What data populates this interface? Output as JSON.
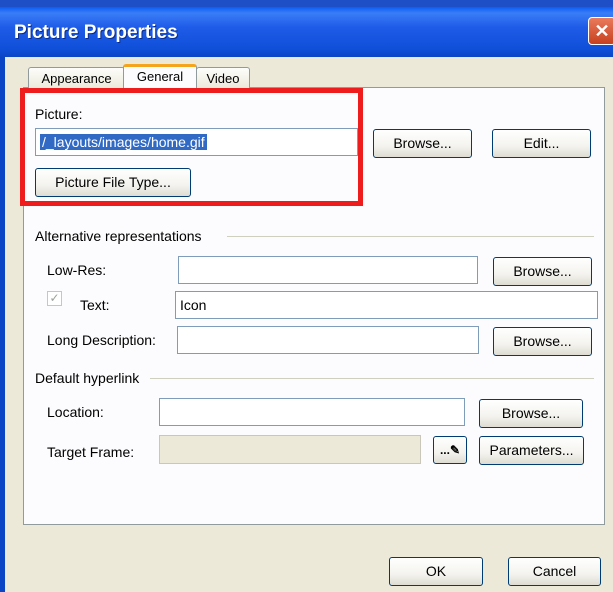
{
  "window": {
    "title": "Picture Properties",
    "close_glyph": "✕"
  },
  "tabs": [
    {
      "label": "Appearance"
    },
    {
      "label": "General"
    },
    {
      "label": "Video"
    }
  ],
  "picture": {
    "label": "Picture:",
    "value": "/_layouts/images/home.gif",
    "browse": "Browse...",
    "edit": "Edit...",
    "file_type": "Picture File Type..."
  },
  "alternative": {
    "section": "Alternative representations",
    "lowres_label": "Low-Res:",
    "lowres_value": "",
    "lowres_browse": "Browse...",
    "text_label": "Text:",
    "text_value": "Icon",
    "text_checked_glyph": "✓",
    "longdesc_label": "Long Description:",
    "longdesc_value": "",
    "longdesc_browse": "Browse..."
  },
  "hyperlink": {
    "section": "Default hyperlink",
    "location_label": "Location:",
    "location_value": "",
    "location_browse": "Browse...",
    "target_label": "Target Frame:",
    "target_value": "",
    "target_icon_glyph": "...✎",
    "parameters": "Parameters..."
  },
  "footer": {
    "ok": "OK",
    "cancel": "Cancel"
  },
  "colors": {
    "titlebar": "#0a45c5",
    "highlight": "#ee1c1c",
    "tab_accent": "#f5a51d"
  }
}
